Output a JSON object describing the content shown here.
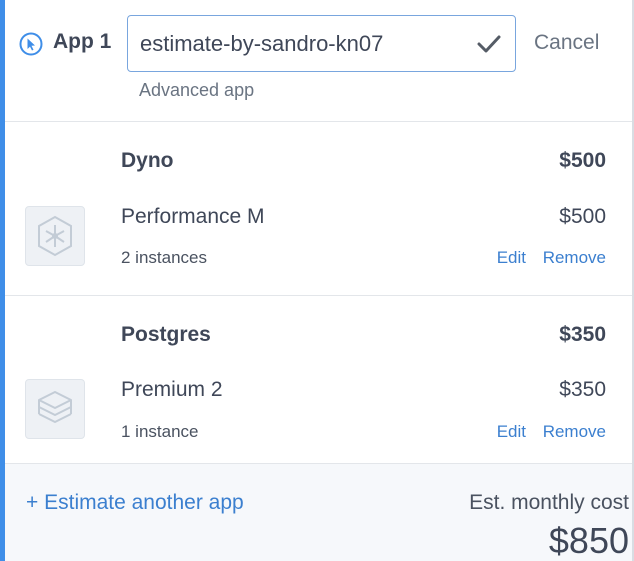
{
  "app": {
    "label": "App 1",
    "name_value": "estimate-by-sandro-kn07",
    "subtitle": "Advanced app",
    "cancel_label": "Cancel"
  },
  "resources": [
    {
      "title": "Dyno",
      "total": "$500",
      "icon": "dyno-hexagon-icon",
      "plan": "Performance M",
      "price": "$500",
      "quantity": "2 instances",
      "edit_label": "Edit",
      "remove_label": "Remove"
    },
    {
      "title": "Postgres",
      "total": "$350",
      "icon": "postgres-database-icon",
      "plan": "Premium 2",
      "price": "$350",
      "quantity": "1 instance",
      "edit_label": "Edit",
      "remove_label": "Remove"
    }
  ],
  "footer": {
    "add_app_label": "+ Estimate another app",
    "est_label": "Est. monthly cost",
    "est_total": "$850"
  },
  "colors": {
    "accent": "#3f8ee8",
    "link": "#3b7fcf",
    "text": "#3f4758"
  }
}
